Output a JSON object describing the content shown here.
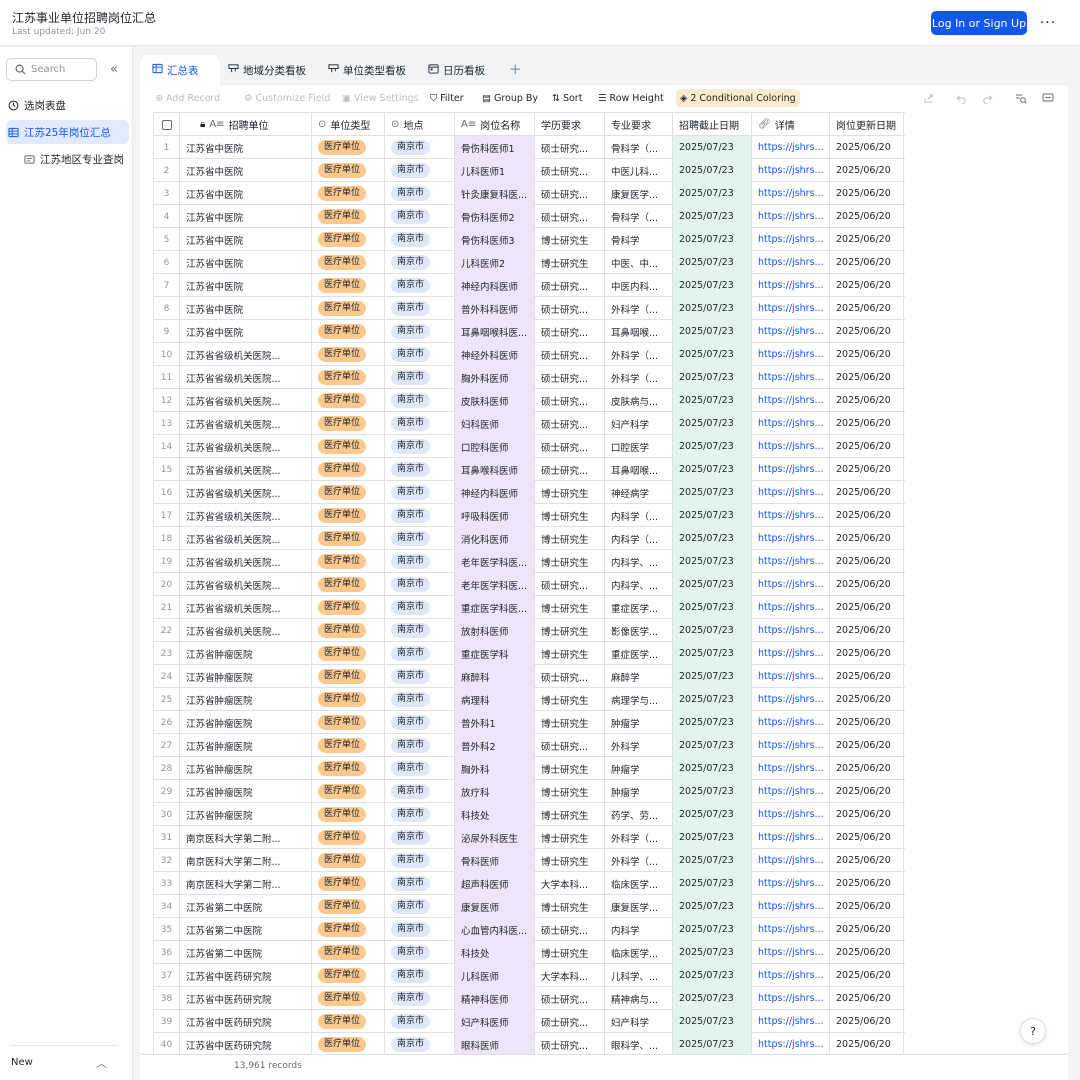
{
  "app": {
    "title": "江苏事业单位招聘岗位汇总",
    "updated": "Last updated: Jun 20",
    "login_label": "Log In or Sign Up",
    "more_label": "···"
  },
  "sidebar": {
    "search_placeholder": "Search",
    "items": [
      {
        "label": "选岗表盘",
        "icon": "dashboard-icon"
      },
      {
        "label": "江苏25年岗位汇总",
        "icon": "table-icon",
        "active": true
      },
      {
        "label": "江苏地区专业查岗",
        "icon": "form-icon"
      }
    ],
    "new_label": "New"
  },
  "tabs": [
    {
      "label": "汇总表",
      "icon": "grid-icon"
    },
    {
      "label": "地域分类看板",
      "icon": "kanban-icon"
    },
    {
      "label": "单位类型看板",
      "icon": "kanban-icon"
    },
    {
      "label": "日历看板",
      "icon": "calendar-icon"
    }
  ],
  "toolbar": {
    "add_record": "Add Record",
    "customize_field": "Customize Field",
    "view_settings": "View Settings",
    "filter": "Filter",
    "group_by": "Group By",
    "sort": "Sort",
    "row_height": "Row Height",
    "conditional_coloring": "2 Conditional Coloring"
  },
  "columns": [
    "招聘单位",
    "单位类型",
    "地点",
    "岗位名称",
    "学历要求",
    "专业要求",
    "招聘截止日期",
    "详情",
    "岗位更新日期"
  ],
  "rows": [
    [
      "1",
      "江苏省中医院",
      "医疗单位",
      "南京市",
      "骨伤科医师1",
      "硕士研究...",
      "骨科学（...",
      "2025/07/23",
      "https://jshrs...",
      "2025/06/20"
    ],
    [
      "2",
      "江苏省中医院",
      "医疗单位",
      "南京市",
      "儿科医师1",
      "硕士研究...",
      "中医儿科...",
      "2025/07/23",
      "https://jshrs...",
      "2025/06/20"
    ],
    [
      "3",
      "江苏省中医院",
      "医疗单位",
      "南京市",
      "针灸康复科医...",
      "硕士研究...",
      "康复医学...",
      "2025/07/23",
      "https://jshrs...",
      "2025/06/20"
    ],
    [
      "4",
      "江苏省中医院",
      "医疗单位",
      "南京市",
      "骨伤科医师2",
      "硕士研究...",
      "骨科学（...",
      "2025/07/23",
      "https://jshrs...",
      "2025/06/20"
    ],
    [
      "5",
      "江苏省中医院",
      "医疗单位",
      "南京市",
      "骨伤科医师3",
      "博士研究生",
      "骨科学",
      "2025/07/23",
      "https://jshrs...",
      "2025/06/20"
    ],
    [
      "6",
      "江苏省中医院",
      "医疗单位",
      "南京市",
      "儿科医师2",
      "博士研究生",
      "中医、中...",
      "2025/07/23",
      "https://jshrs...",
      "2025/06/20"
    ],
    [
      "7",
      "江苏省中医院",
      "医疗单位",
      "南京市",
      "神经内科医师",
      "硕士研究...",
      "中医内科...",
      "2025/07/23",
      "https://jshrs...",
      "2025/06/20"
    ],
    [
      "8",
      "江苏省中医院",
      "医疗单位",
      "南京市",
      "普外科科医师",
      "硕士研究...",
      "外科学（...",
      "2025/07/23",
      "https://jshrs...",
      "2025/06/20"
    ],
    [
      "9",
      "江苏省中医院",
      "医疗单位",
      "南京市",
      "耳鼻咽喉科医...",
      "硕士研究...",
      "耳鼻咽喉...",
      "2025/07/23",
      "https://jshrs...",
      "2025/06/20"
    ],
    [
      "10",
      "江苏省省级机关医院...",
      "医疗单位",
      "南京市",
      "神经外科医师",
      "硕士研究...",
      "外科学（...",
      "2025/07/23",
      "https://jshrs...",
      "2025/06/20"
    ],
    [
      "11",
      "江苏省省级机关医院...",
      "医疗单位",
      "南京市",
      "胸外科医师",
      "硕士研究...",
      "外科学（...",
      "2025/07/23",
      "https://jshrs...",
      "2025/06/20"
    ],
    [
      "12",
      "江苏省省级机关医院...",
      "医疗单位",
      "南京市",
      "皮肤科医师",
      "硕士研究...",
      "皮肤病与...",
      "2025/07/23",
      "https://jshrs...",
      "2025/06/20"
    ],
    [
      "13",
      "江苏省省级机关医院...",
      "医疗单位",
      "南京市",
      "妇科医师",
      "硕士研究...",
      "妇产科学",
      "2025/07/23",
      "https://jshrs...",
      "2025/06/20"
    ],
    [
      "14",
      "江苏省省级机关医院...",
      "医疗单位",
      "南京市",
      "口腔科医师",
      "硕士研究...",
      "口腔医学",
      "2025/07/23",
      "https://jshrs...",
      "2025/06/20"
    ],
    [
      "15",
      "江苏省省级机关医院...",
      "医疗单位",
      "南京市",
      "耳鼻喉科医师",
      "硕士研究...",
      "耳鼻咽喉...",
      "2025/07/23",
      "https://jshrs...",
      "2025/06/20"
    ],
    [
      "16",
      "江苏省省级机关医院...",
      "医疗单位",
      "南京市",
      "神经内科医师",
      "博士研究生",
      "神经病学",
      "2025/07/23",
      "https://jshrs...",
      "2025/06/20"
    ],
    [
      "17",
      "江苏省省级机关医院...",
      "医疗单位",
      "南京市",
      "呼吸科医师",
      "博士研究生",
      "内科学（...",
      "2025/07/23",
      "https://jshrs...",
      "2025/06/20"
    ],
    [
      "18",
      "江苏省省级机关医院...",
      "医疗单位",
      "南京市",
      "消化科医师",
      "博士研究生",
      "内科学（...",
      "2025/07/23",
      "https://jshrs...",
      "2025/06/20"
    ],
    [
      "19",
      "江苏省省级机关医院...",
      "医疗单位",
      "南京市",
      "老年医学科医...",
      "博士研究生",
      "内科学、...",
      "2025/07/23",
      "https://jshrs...",
      "2025/06/20"
    ],
    [
      "20",
      "江苏省省级机关医院...",
      "医疗单位",
      "南京市",
      "老年医学科医...",
      "硕士研究...",
      "内科学、...",
      "2025/07/23",
      "https://jshrs...",
      "2025/06/20"
    ],
    [
      "21",
      "江苏省省级机关医院...",
      "医疗单位",
      "南京市",
      "重症医学科医...",
      "博士研究生",
      "重症医学...",
      "2025/07/23",
      "https://jshrs...",
      "2025/06/20"
    ],
    [
      "22",
      "江苏省省级机关医院...",
      "医疗单位",
      "南京市",
      "放射科医师",
      "博士研究生",
      "影像医学...",
      "2025/07/23",
      "https://jshrs...",
      "2025/06/20"
    ],
    [
      "23",
      "江苏省肿瘤医院",
      "医疗单位",
      "南京市",
      "重症医学科",
      "博士研究生",
      "重症医学...",
      "2025/07/23",
      "https://jshrs...",
      "2025/06/20"
    ],
    [
      "24",
      "江苏省肿瘤医院",
      "医疗单位",
      "南京市",
      "麻醉科",
      "硕士研究...",
      "麻醉学",
      "2025/07/23",
      "https://jshrs...",
      "2025/06/20"
    ],
    [
      "25",
      "江苏省肿瘤医院",
      "医疗单位",
      "南京市",
      "病理科",
      "博士研究生",
      "病理学与...",
      "2025/07/23",
      "https://jshrs...",
      "2025/06/20"
    ],
    [
      "26",
      "江苏省肿瘤医院",
      "医疗单位",
      "南京市",
      "普外科1",
      "博士研究生",
      "肿瘤学",
      "2025/07/23",
      "https://jshrs...",
      "2025/06/20"
    ],
    [
      "27",
      "江苏省肿瘤医院",
      "医疗单位",
      "南京市",
      "普外科2",
      "硕士研究...",
      "外科学",
      "2025/07/23",
      "https://jshrs...",
      "2025/06/20"
    ],
    [
      "28",
      "江苏省肿瘤医院",
      "医疗单位",
      "南京市",
      "胸外科",
      "博士研究生",
      "肿瘤学",
      "2025/07/23",
      "https://jshrs...",
      "2025/06/20"
    ],
    [
      "29",
      "江苏省肿瘤医院",
      "医疗单位",
      "南京市",
      "放疗科",
      "博士研究生",
      "肿瘤学",
      "2025/07/23",
      "https://jshrs...",
      "2025/06/20"
    ],
    [
      "30",
      "江苏省肿瘤医院",
      "医疗单位",
      "南京市",
      "科技处",
      "博士研究生",
      "药学、劳...",
      "2025/07/23",
      "https://jshrs...",
      "2025/06/20"
    ],
    [
      "31",
      "南京医科大学第二附...",
      "医疗单位",
      "南京市",
      "泌尿外科医生",
      "博士研究生",
      "外科学（...",
      "2025/07/23",
      "https://jshrs...",
      "2025/06/20"
    ],
    [
      "32",
      "南京医科大学第二附...",
      "医疗单位",
      "南京市",
      "骨科医师",
      "博士研究生",
      "外科学（...",
      "2025/07/23",
      "https://jshrs...",
      "2025/06/20"
    ],
    [
      "33",
      "南京医科大学第二附...",
      "医疗单位",
      "南京市",
      "超声科医师",
      "大学本科...",
      "临床医学...",
      "2025/07/23",
      "https://jshrs...",
      "2025/06/20"
    ],
    [
      "34",
      "江苏省第二中医院",
      "医疗单位",
      "南京市",
      "康复医师",
      "博士研究生",
      "康复医学...",
      "2025/07/23",
      "https://jshrs...",
      "2025/06/20"
    ],
    [
      "35",
      "江苏省第二中医院",
      "医疗单位",
      "南京市",
      "心血管内科医...",
      "硕士研究...",
      "内科学",
      "2025/07/23",
      "https://jshrs...",
      "2025/06/20"
    ],
    [
      "36",
      "江苏省第二中医院",
      "医疗单位",
      "南京市",
      "科技处",
      "博士研究生",
      "临床医学...",
      "2025/07/23",
      "https://jshrs...",
      "2025/06/20"
    ],
    [
      "37",
      "江苏省中医药研究院",
      "医疗单位",
      "南京市",
      "儿科医师",
      "大学本科...",
      "儿科学、...",
      "2025/07/23",
      "https://jshrs...",
      "2025/06/20"
    ],
    [
      "38",
      "江苏省中医药研究院",
      "医疗单位",
      "南京市",
      "精神科医师",
      "硕士研究...",
      "精神病与...",
      "2025/07/23",
      "https://jshrs...",
      "2025/06/20"
    ],
    [
      "39",
      "江苏省中医药研究院",
      "医疗单位",
      "南京市",
      "妇产科医师",
      "硕士研究...",
      "妇产科学",
      "2025/07/23",
      "https://jshrs...",
      "2025/06/20"
    ],
    [
      "40",
      "江苏省中医药研究院",
      "医疗单位",
      "南京市",
      "眼科医师",
      "硕士研究...",
      "眼科学、...",
      "2025/07/23",
      "https://jshrs...",
      "2025/06/20"
    ]
  ],
  "footer": {
    "record_count": "13,961 records",
    "help_label": "?"
  },
  "colors": {
    "accent": "#1456f0",
    "org_tag": "#fbc98f",
    "loc_tag": "#dfe8fb",
    "position_column": "#ede6fa",
    "deadline_column": "#e1f5ee",
    "coloring_chip": "#fdebd0"
  }
}
